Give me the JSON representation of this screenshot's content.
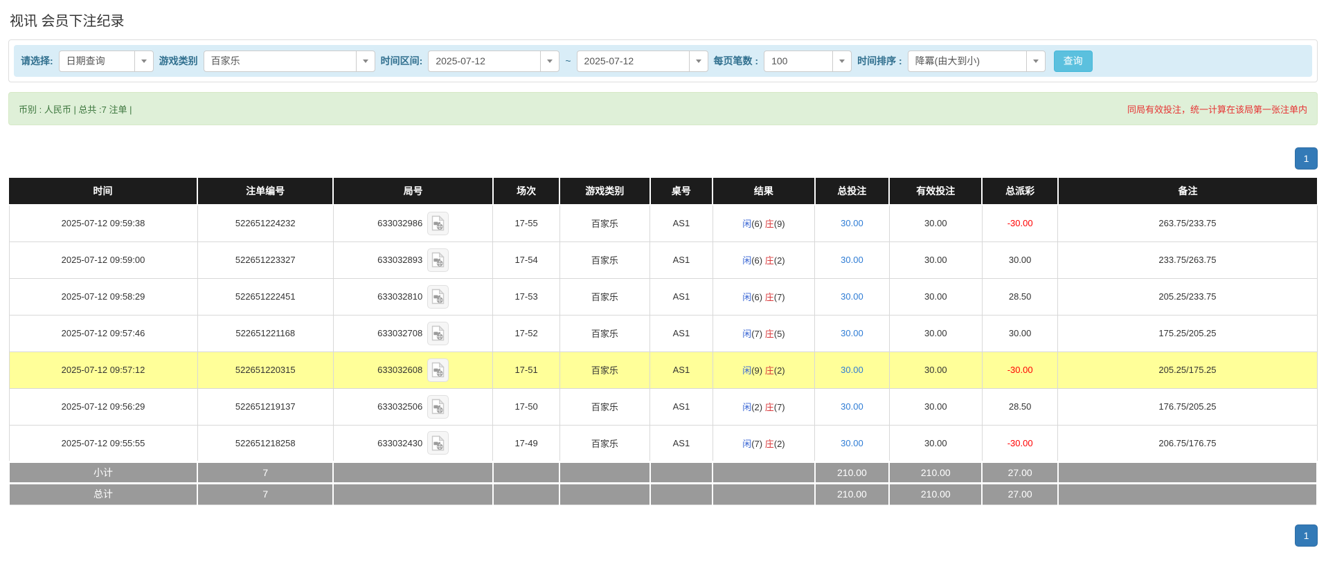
{
  "page": {
    "title": "视讯 会员下注纪录"
  },
  "filters": {
    "select_label": "请选择:",
    "select_value": "日期查询",
    "game_type_label": "游戏类别",
    "game_type_value": "百家乐",
    "time_range_label": "时间区间:",
    "time_from": "2025-07-12",
    "tilde": "~",
    "time_to": "2025-07-12",
    "page_size_label": "每页笔数 :",
    "page_size_value": "100",
    "sort_label": "时间排序 :",
    "sort_value": "降冪(由大到小)",
    "search_button": "查询"
  },
  "summary_bar": {
    "left_text": "币别 : 人民币 | 总共 :7 注单 |",
    "right_note": "同局有效投注，统一计算在该局第一张注单内"
  },
  "pagination": {
    "page": "1"
  },
  "table": {
    "headers": [
      "时间",
      "注单编号",
      "局号",
      "场次",
      "游戏类别",
      "桌号",
      "结果",
      "总投注",
      "有效投注",
      "总派彩",
      "备注"
    ],
    "rows": [
      {
        "time": "2025-07-12 09:59:38",
        "bet_id": "522651224232",
        "round": "633032986",
        "session": "17-55",
        "game_type": "百家乐",
        "table_no": "AS1",
        "result": {
          "player_label": "闲",
          "player_score": "(6)",
          "banker_label": "庄",
          "banker_score": "(9)"
        },
        "total_bet": "30.00",
        "valid_bet": "30.00",
        "payout": "-30.00",
        "remark": "263.75/233.75",
        "highlight": false
      },
      {
        "time": "2025-07-12 09:59:00",
        "bet_id": "522651223327",
        "round": "633032893",
        "session": "17-54",
        "game_type": "百家乐",
        "table_no": "AS1",
        "result": {
          "player_label": "闲",
          "player_score": "(6)",
          "banker_label": "庄",
          "banker_score": "(2)"
        },
        "total_bet": "30.00",
        "valid_bet": "30.00",
        "payout": "30.00",
        "remark": "233.75/263.75",
        "highlight": false
      },
      {
        "time": "2025-07-12 09:58:29",
        "bet_id": "522651222451",
        "round": "633032810",
        "session": "17-53",
        "game_type": "百家乐",
        "table_no": "AS1",
        "result": {
          "player_label": "闲",
          "player_score": "(6)",
          "banker_label": "庄",
          "banker_score": "(7)"
        },
        "total_bet": "30.00",
        "valid_bet": "30.00",
        "payout": "28.50",
        "remark": "205.25/233.75",
        "highlight": false
      },
      {
        "time": "2025-07-12 09:57:46",
        "bet_id": "522651221168",
        "round": "633032708",
        "session": "17-52",
        "game_type": "百家乐",
        "table_no": "AS1",
        "result": {
          "player_label": "闲",
          "player_score": "(7)",
          "banker_label": "庄",
          "banker_score": "(5)"
        },
        "total_bet": "30.00",
        "valid_bet": "30.00",
        "payout": "30.00",
        "remark": "175.25/205.25",
        "highlight": false
      },
      {
        "time": "2025-07-12 09:57:12",
        "bet_id": "522651220315",
        "round": "633032608",
        "session": "17-51",
        "game_type": "百家乐",
        "table_no": "AS1",
        "result": {
          "player_label": "闲",
          "player_score": "(9)",
          "banker_label": "庄",
          "banker_score": "(2)"
        },
        "total_bet": "30.00",
        "valid_bet": "30.00",
        "payout": "-30.00",
        "remark": "205.25/175.25",
        "highlight": true
      },
      {
        "time": "2025-07-12 09:56:29",
        "bet_id": "522651219137",
        "round": "633032506",
        "session": "17-50",
        "game_type": "百家乐",
        "table_no": "AS1",
        "result": {
          "player_label": "闲",
          "player_score": "(2)",
          "banker_label": "庄",
          "banker_score": "(7)"
        },
        "total_bet": "30.00",
        "valid_bet": "30.00",
        "payout": "28.50",
        "remark": "176.75/205.25",
        "highlight": false
      },
      {
        "time": "2025-07-12 09:55:55",
        "bet_id": "522651218258",
        "round": "633032430",
        "session": "17-49",
        "game_type": "百家乐",
        "table_no": "AS1",
        "result": {
          "player_label": "闲",
          "player_score": "(7)",
          "banker_label": "庄",
          "banker_score": "(2)"
        },
        "total_bet": "30.00",
        "valid_bet": "30.00",
        "payout": "-30.00",
        "remark": "206.75/176.75",
        "highlight": false
      }
    ],
    "subtotal": {
      "label": "小计",
      "count": "7",
      "total_bet": "210.00",
      "valid_bet": "210.00",
      "total_payout": "27.00"
    },
    "grand_total": {
      "label": "总计",
      "count": "7",
      "total_bet": "210.00",
      "valid_bet": "210.00",
      "total_payout": "27.00"
    }
  },
  "colors": {
    "filter_bar_bg": "#d9edf7",
    "query_button_bg": "#5bc0de",
    "summary_bar_bg": "#dff0d8",
    "summary_text_green": "#3c763d",
    "note_red": "#e63333",
    "header_bg": "#1c1c1c",
    "highlight_row": "#ffff99",
    "summary_row_bg": "#9a9a9a",
    "pagination_blue": "#337ab7",
    "player_blue": "#3a66d4",
    "banker_red": "#d9383a",
    "bet_link_blue": "#2d7bd4",
    "negative_red": "#ff0000"
  }
}
